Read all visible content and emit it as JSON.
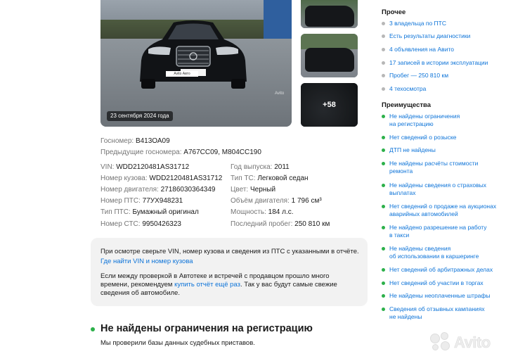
{
  "gallery": {
    "photo_date": "23 сентября 2024 года",
    "plate_badge": "Avito Авто",
    "photo_watermark": "Avito",
    "more_count": "+58"
  },
  "registration": {
    "gosnomer_label": "Госномер:",
    "gosnomer_value": "В413ОА09",
    "prev_label": "Предыдущие госномера:",
    "prev_value": "А767СС09, М804СС190"
  },
  "specs_left": [
    {
      "label": "VIN:",
      "value": "WDD2120481AS31712"
    },
    {
      "label": "Номер кузова:",
      "value": "WDD2120481AS31712"
    },
    {
      "label": "Номер двигателя:",
      "value": "27186030364349"
    },
    {
      "label": "Номер ПТС:",
      "value": "77УХ948231"
    },
    {
      "label": "Тип ПТС:",
      "value": "Бумажный оригинал"
    },
    {
      "label": "Номер СТС:",
      "value": "9950426323"
    }
  ],
  "specs_right": [
    {
      "label": "Год выпуска:",
      "value": "2011"
    },
    {
      "label": "Тип ТС:",
      "value": "Легковой седан"
    },
    {
      "label": "Цвет:",
      "value": "Черный"
    },
    {
      "label": "Объём двигателя:",
      "value": "1 796 см³"
    },
    {
      "label": "Мощность:",
      "value": "184 л.с."
    },
    {
      "label": "Последний пробег:",
      "value": "250 810 км"
    }
  ],
  "info_box": {
    "line1": "При осмотре сверьте VIN, номер кузова и сведения из ПТС с указанными в отчёте.",
    "link1": "Где найти VIN и номер кузова",
    "line2": "Если между проверкой в Автотеке и встречей с продавцом прошло много",
    "line3_pre": "времени, рекомендуем ",
    "link2": "купить отчёт ещё раз",
    "line3_post": ". Так у вас будут самые свежие",
    "line4": "сведения об автомобиле."
  },
  "section": {
    "title": "Не найдены ограничения на регистрацию",
    "subtitle": "Мы проверили базы данных судебных приставов."
  },
  "sidebar": {
    "other_heading": "Прочее",
    "other_items": [
      "3 владельца по ПТС",
      "Есть результаты диагностики",
      "4 объявления на Авито",
      "17 записей в истории эксплуатации",
      "Пробег — 250 810 км",
      "4 техосмотра"
    ],
    "adv_heading": "Преимущества",
    "adv_items": [
      [
        "Не найдены ограничения",
        "на регистрацию"
      ],
      [
        "Нет сведений о розыске"
      ],
      [
        "ДТП не найдены"
      ],
      [
        "Не найдены расчёты стоимости",
        "ремонта"
      ],
      [
        "Не найдены сведения о страховых",
        "выплатах"
      ],
      [
        "Нет сведений о продаже на аукционах",
        "аварийных автомобилей"
      ],
      [
        "Не найдено разрешение на работу",
        "в такси"
      ],
      [
        "Не найдены сведения",
        "об использовании в каршеринге"
      ],
      [
        "Нет сведений об арбитражных делах"
      ],
      [
        "Нет сведений об участии в торгах"
      ],
      [
        "Не найдены неоплаченные штрафы"
      ],
      [
        "Сведения об отзывных кампаниях",
        "не найдены"
      ]
    ]
  },
  "watermark": {
    "text": "Avito"
  }
}
